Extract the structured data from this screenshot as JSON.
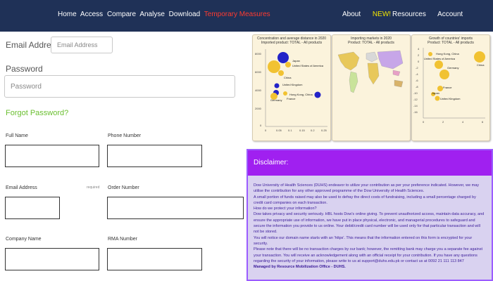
{
  "nav": {
    "left": [
      "Home",
      "Access",
      "Compare",
      "Analyse",
      "Download"
    ],
    "alert": "Temporary Measures",
    "about": "About",
    "new_badge": "NEW!",
    "resources": "Resources",
    "account": "Account"
  },
  "login": {
    "email_label": "Email Address",
    "email_placeholder": "Email Address",
    "password_label": "Password",
    "password_placeholder": "Password",
    "forgot": "Forgot Password?"
  },
  "form": {
    "full_name": "Full Name",
    "phone": "Phone Number",
    "email": "Email Address",
    "required": "required",
    "order": "Order Number",
    "company": "Company Name",
    "rma": "RMA Number"
  },
  "charts": [
    {
      "title_line1": "Concentration and average distance in 2020",
      "title_line2": "Imported product: TOTAL - All products",
      "y_ticks": [
        "8000",
        "6000",
        "4000",
        "2000",
        "0"
      ],
      "x_ticks": [
        "0",
        "0.05",
        "0.1",
        "0.15",
        "0.2",
        "0.25"
      ],
      "labels": [
        "Japan",
        "United States of America",
        "China",
        "United Kingdom",
        "Hong Kong, China",
        "Germany",
        "France"
      ]
    },
    {
      "title_line1": "Importing markets in 2020",
      "title_line2": "Product: TOTAL - All products"
    },
    {
      "title_line1": "Growth of countries' imports",
      "title_line2": "Product: TOTAL - All products",
      "y_ticks": [
        "4",
        "2",
        "0",
        "-2",
        "-4",
        "-6",
        "-8",
        "-10",
        "-12",
        "-14",
        "-16"
      ],
      "x_ticks": [
        "0",
        "2",
        "4",
        "6"
      ],
      "labels": [
        "Hong Kong, China",
        "United States of America",
        "Germany",
        "France",
        "Japan",
        "United Kingdom",
        "China"
      ]
    }
  ],
  "disclaimer": {
    "title": "Disclaimer:",
    "paragraphs": [
      "Dow University of Health Sciences (DUHS) endeavor to utilize your contribution as per your preference indicated. However, we may utilise the contribution for any other approved programme of the Dow University of Health Sciences.",
      "A small portion of funds raised may also be used to defray the direct costs of fundraising, including a small percentage charged by credit card companies on each transaction.",
      "How do we protect your information?",
      "Dow takes privacy and security seriously. HBL hosts Dow's online giving. To prevent unauthorized access, maintain data accuracy, and ensure the appropriate use of information, we have put in place physical, electronic, and managerial procedures to safeguard and secure the information you provide to us online. Your debit/credit card number will be used only for that particular transaction and will not be stored.",
      "You will notice our domain name starts with an 'https'. This means that the information entered on this form is encrypted for your security.",
      "Please note that there will be no transaction charges by our bank; however, the remitting bank may charge you a separate fee against your transaction. You will receive an acknowledgement along with an official receipt for your contribution. If you have any questions regarding the security of your information, please write to us at support@duhs.edu.pk or contact us at 0092 21 111 113 847",
      "Managed by Resource Mobilization Office - DUHS."
    ]
  }
}
